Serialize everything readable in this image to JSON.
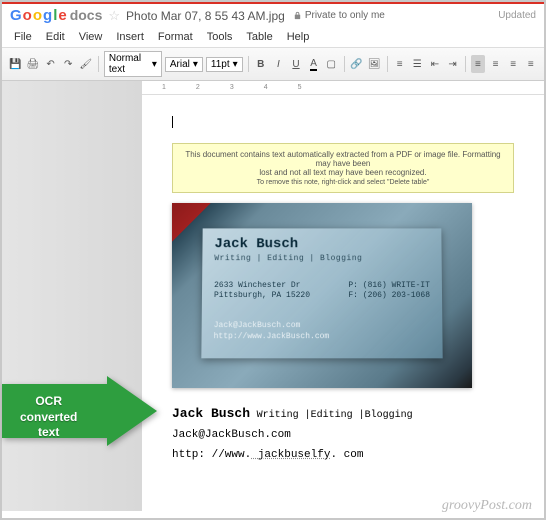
{
  "header": {
    "logo": {
      "g1": "G",
      "o1": "o",
      "o2": "o",
      "g2": "g",
      "l": "l",
      "e": "e",
      "product": "docs"
    },
    "filename": "Photo Mar 07, 8 55 43 AM.jpg",
    "privacy": "Private to only me",
    "status": "Updated"
  },
  "menubar": [
    "File",
    "Edit",
    "View",
    "Insert",
    "Format",
    "Tools",
    "Table",
    "Help"
  ],
  "toolbar": {
    "style": "Normal text",
    "font": "Arial",
    "size": "11pt"
  },
  "notice": {
    "line1": "This document contains text automatically extracted from a PDF or image file. Formatting may have been",
    "line2": "lost and not all text may have been recognized.",
    "line3": "To remove this note, right-click and select \"Delete table\""
  },
  "card": {
    "name": "Jack Busch",
    "tag": "Writing | Editing | Blogging",
    "addr1": "2633 Winchester Dr",
    "addr2": "Pittsburgh, PA 15220",
    "phone1": "P: (816) WRITE-IT",
    "phone2": "F: (206) 203-1068",
    "email": "Jack@JackBusch.com",
    "url": "http://www.JackBusch.com"
  },
  "ocr": {
    "name": "Jack Busch",
    "tag": "Writing |Editing |Blogging",
    "email": "Jack@JackBusch.com",
    "url_prefix": "http: //www.",
    "url_mid": " jackbuselfy",
    "url_suffix": ". com"
  },
  "arrow_label_1": "OCR",
  "arrow_label_2": "converted",
  "arrow_label_3": "text",
  "watermark": "groovyPost.com",
  "ruler_ticks": [
    "1",
    "2",
    "3",
    "4",
    "5"
  ]
}
